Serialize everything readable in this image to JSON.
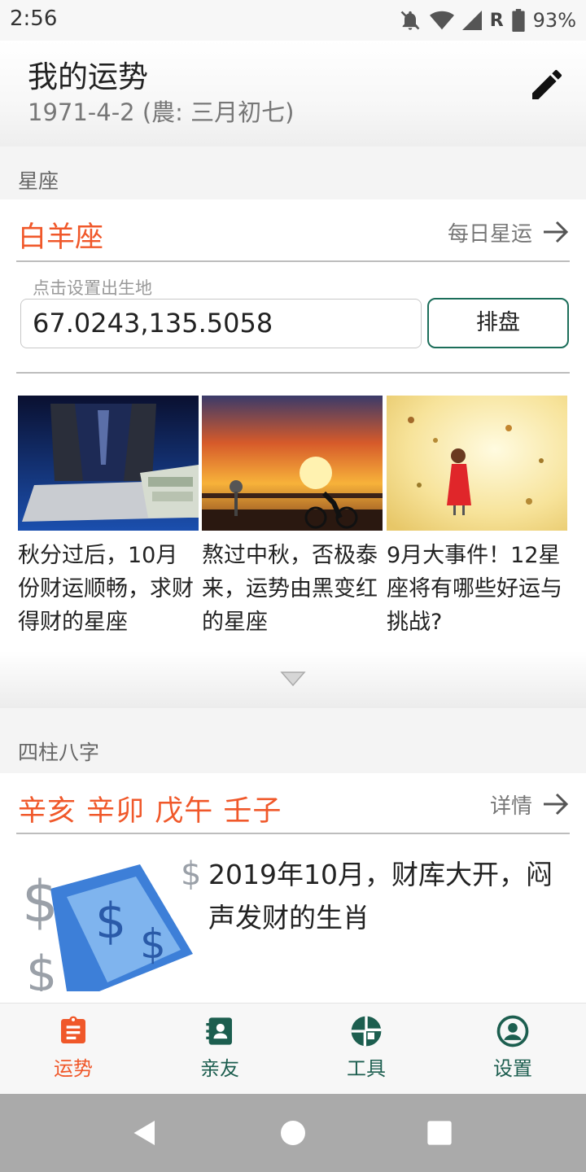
{
  "status_bar": {
    "time": "2:56",
    "roaming": "R",
    "battery": "93%",
    "icons": [
      "mute-bell-icon",
      "wifi-icon",
      "signal-icon",
      "battery-icon"
    ]
  },
  "header": {
    "title": "我的运势",
    "birth_date": "1971-4-2 (農: 三月初七)",
    "edit_icon": "pencil-icon"
  },
  "zodiac": {
    "section_label": "星座",
    "sign": "白羊座",
    "link_label": "每日星运",
    "place_hint": "点击设置出生地",
    "coordinates": "67.0243,135.5058",
    "chart_button": "排盘",
    "articles": [
      {
        "caption": "秋分过后，10月份财运顺畅，求财得财的星座",
        "image": "laptop-money-image"
      },
      {
        "caption": "熬过中秋，否极泰来，运势由黑变红的星座",
        "image": "sunset-cyclist-image"
      },
      {
        "caption": "9月大事件！12星座将有哪些好运与挑战?",
        "image": "girl-autumn-leaves-image"
      }
    ]
  },
  "bazi": {
    "section_label": "四柱八字",
    "pillars": "辛亥 辛卯 戊午 壬子",
    "link_label": "详情",
    "article_title": "2019年10月，财库大开，闷声发财的生肖",
    "article_image": "phone-dollar-image"
  },
  "bottom_nav": [
    {
      "label": "运势",
      "icon": "clipboard-icon",
      "active": true
    },
    {
      "label": "亲友",
      "icon": "contacts-book-icon",
      "active": false
    },
    {
      "label": "工具",
      "icon": "aperture-icon",
      "active": false
    },
    {
      "label": "设置",
      "icon": "account-circle-icon",
      "active": false
    }
  ],
  "colors": {
    "accent": "#f0582a",
    "nav_inactive": "#1c5e4f",
    "button_border": "#1c6e5a"
  }
}
